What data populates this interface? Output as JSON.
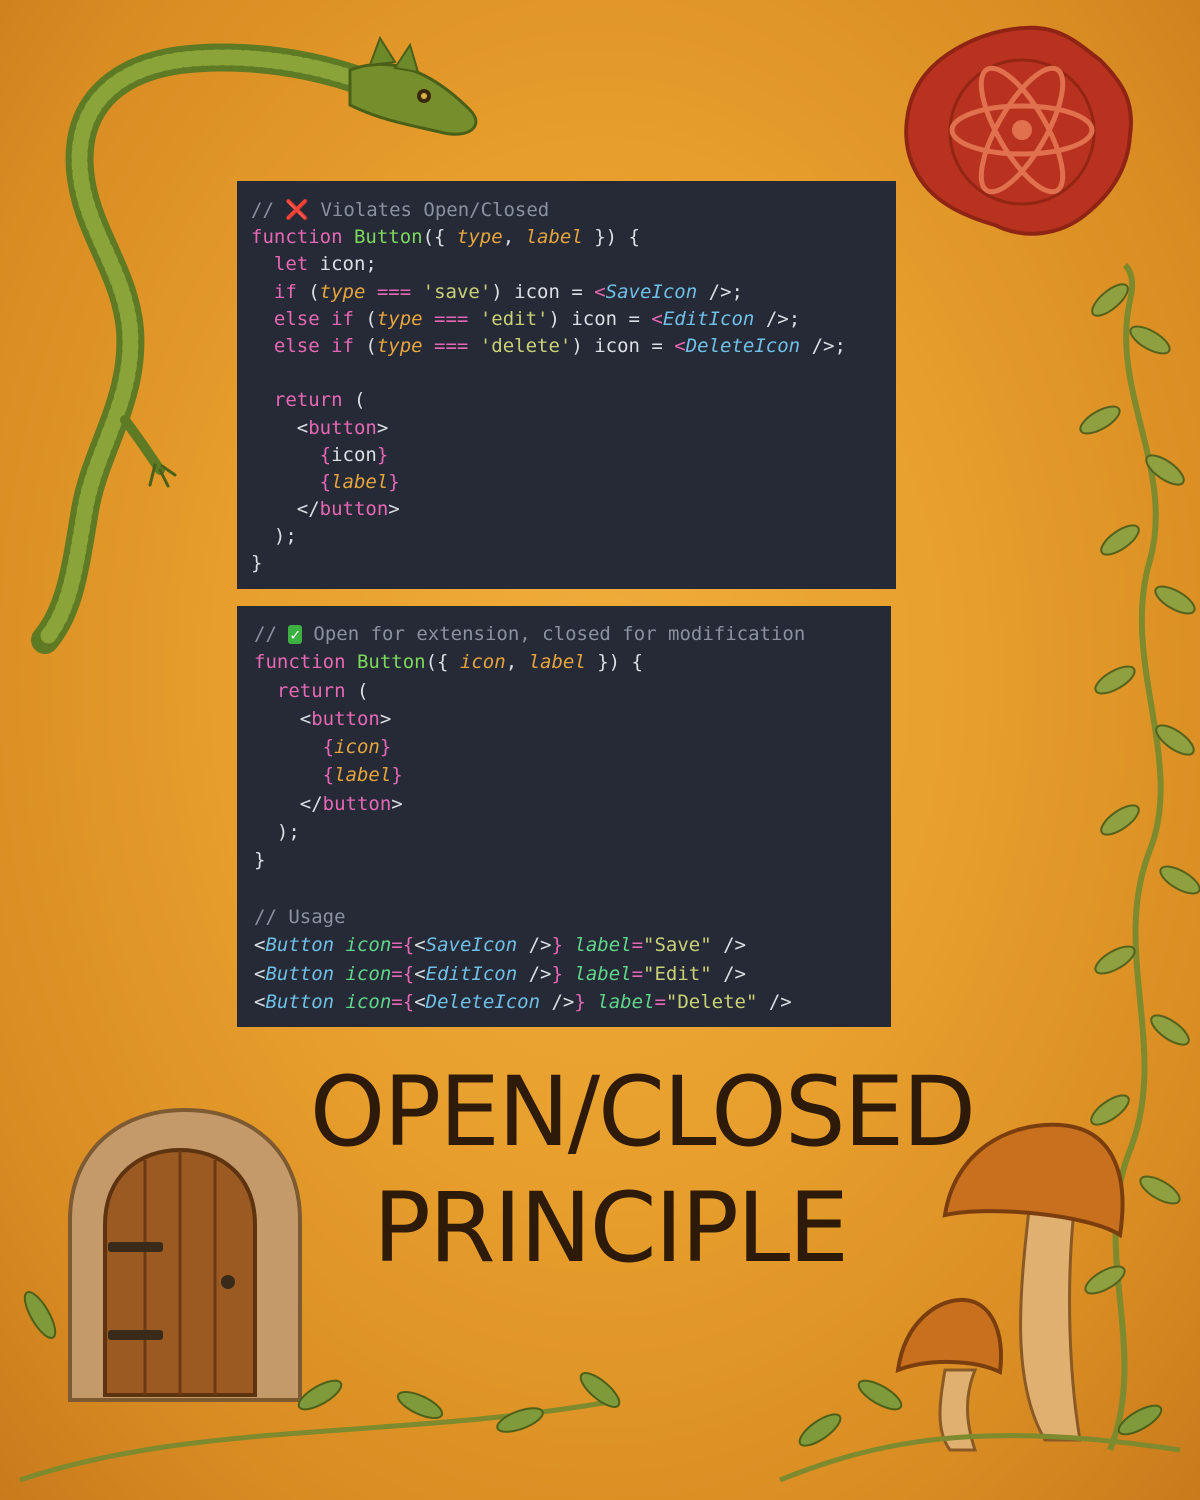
{
  "panel1": {
    "lines": [
      [
        {
          "t": "// ",
          "c": "com"
        },
        {
          "t": "❌",
          "c": "x"
        },
        {
          "t": " Violates Open/Closed",
          "c": "com"
        }
      ],
      [
        {
          "t": "function ",
          "c": "kw"
        },
        {
          "t": "Button",
          "c": "fn"
        },
        {
          "t": "({ ",
          "c": "pl"
        },
        {
          "t": "type",
          "c": "par"
        },
        {
          "t": ", ",
          "c": "pl"
        },
        {
          "t": "label",
          "c": "par"
        },
        {
          "t": " }) {",
          "c": "pl"
        }
      ],
      [
        {
          "t": "  let ",
          "c": "kw"
        },
        {
          "t": "icon;",
          "c": "pl"
        }
      ],
      [
        {
          "t": "  if ",
          "c": "kw"
        },
        {
          "t": "(",
          "c": "pl"
        },
        {
          "t": "type",
          "c": "par"
        },
        {
          "t": " === ",
          "c": "kw"
        },
        {
          "t": "'save'",
          "c": "str"
        },
        {
          "t": ") icon = ",
          "c": "pl"
        },
        {
          "t": "<",
          "c": "tag"
        },
        {
          "t": "SaveIcon",
          "c": "cmp"
        },
        {
          "t": " />;",
          "c": "pl"
        }
      ],
      [
        {
          "t": "  else if ",
          "c": "kw"
        },
        {
          "t": "(",
          "c": "pl"
        },
        {
          "t": "type",
          "c": "par"
        },
        {
          "t": " === ",
          "c": "kw"
        },
        {
          "t": "'edit'",
          "c": "str"
        },
        {
          "t": ") icon = ",
          "c": "pl"
        },
        {
          "t": "<",
          "c": "tag"
        },
        {
          "t": "EditIcon",
          "c": "cmp"
        },
        {
          "t": " />;",
          "c": "pl"
        }
      ],
      [
        {
          "t": "  else if ",
          "c": "kw"
        },
        {
          "t": "(",
          "c": "pl"
        },
        {
          "t": "type",
          "c": "par"
        },
        {
          "t": " === ",
          "c": "kw"
        },
        {
          "t": "'delete'",
          "c": "str"
        },
        {
          "t": ") icon = ",
          "c": "pl"
        },
        {
          "t": "<",
          "c": "tag"
        },
        {
          "t": "DeleteIcon",
          "c": "cmp"
        },
        {
          "t": " />;",
          "c": "pl"
        }
      ],
      [],
      [
        {
          "t": "  return ",
          "c": "kw"
        },
        {
          "t": "(",
          "c": "pl"
        }
      ],
      [
        {
          "t": "    <",
          "c": "pl"
        },
        {
          "t": "button",
          "c": "tag"
        },
        {
          "t": ">",
          "c": "pl"
        }
      ],
      [
        {
          "t": "      {",
          "c": "br"
        },
        {
          "t": "icon",
          "c": "pl"
        },
        {
          "t": "}",
          "c": "br"
        }
      ],
      [
        {
          "t": "      {",
          "c": "br"
        },
        {
          "t": "label",
          "c": "par"
        },
        {
          "t": "}",
          "c": "br"
        }
      ],
      [
        {
          "t": "    </",
          "c": "pl"
        },
        {
          "t": "button",
          "c": "tag"
        },
        {
          "t": ">",
          "c": "pl"
        }
      ],
      [
        {
          "t": "  );",
          "c": "pl"
        }
      ],
      [
        {
          "t": "}",
          "c": "pl"
        }
      ]
    ]
  },
  "panel2": {
    "lines": [
      [
        {
          "t": "// ",
          "c": "com"
        },
        {
          "t": "✓",
          "c": "ok"
        },
        {
          "t": " Open for extension, closed for modification",
          "c": "com"
        }
      ],
      [
        {
          "t": "function ",
          "c": "kw"
        },
        {
          "t": "Button",
          "c": "fn"
        },
        {
          "t": "({ ",
          "c": "pl"
        },
        {
          "t": "icon",
          "c": "par"
        },
        {
          "t": ", ",
          "c": "pl"
        },
        {
          "t": "label",
          "c": "par"
        },
        {
          "t": " }) {",
          "c": "pl"
        }
      ],
      [
        {
          "t": "  return ",
          "c": "kw"
        },
        {
          "t": "(",
          "c": "pl"
        }
      ],
      [
        {
          "t": "    <",
          "c": "pl"
        },
        {
          "t": "button",
          "c": "tag"
        },
        {
          "t": ">",
          "c": "pl"
        }
      ],
      [
        {
          "t": "      {",
          "c": "br"
        },
        {
          "t": "icon",
          "c": "par"
        },
        {
          "t": "}",
          "c": "br"
        }
      ],
      [
        {
          "t": "      {",
          "c": "br"
        },
        {
          "t": "label",
          "c": "par"
        },
        {
          "t": "}",
          "c": "br"
        }
      ],
      [
        {
          "t": "    </",
          "c": "pl"
        },
        {
          "t": "button",
          "c": "tag"
        },
        {
          "t": ">",
          "c": "pl"
        }
      ],
      [
        {
          "t": "  );",
          "c": "pl"
        }
      ],
      [
        {
          "t": "}",
          "c": "pl"
        }
      ],
      [],
      [
        {
          "t": "// Usage",
          "c": "com"
        }
      ],
      [
        {
          "t": "<",
          "c": "pl"
        },
        {
          "t": "Button",
          "c": "cmp"
        },
        {
          "t": " icon",
          "c": "attr"
        },
        {
          "t": "={",
          "c": "br"
        },
        {
          "t": "<",
          "c": "pl"
        },
        {
          "t": "SaveIcon",
          "c": "cmp"
        },
        {
          "t": " />",
          "c": "pl"
        },
        {
          "t": "}",
          "c": "br"
        },
        {
          "t": " label",
          "c": "attr"
        },
        {
          "t": "=",
          "c": "kw"
        },
        {
          "t": "\"Save\"",
          "c": "str"
        },
        {
          "t": " />",
          "c": "pl"
        }
      ],
      [
        {
          "t": "<",
          "c": "pl"
        },
        {
          "t": "Button",
          "c": "cmp"
        },
        {
          "t": " icon",
          "c": "attr"
        },
        {
          "t": "={",
          "c": "br"
        },
        {
          "t": "<",
          "c": "pl"
        },
        {
          "t": "EditIcon",
          "c": "cmp"
        },
        {
          "t": " />",
          "c": "pl"
        },
        {
          "t": "}",
          "c": "br"
        },
        {
          "t": " label",
          "c": "attr"
        },
        {
          "t": "=",
          "c": "kw"
        },
        {
          "t": "\"Edit\"",
          "c": "str"
        },
        {
          "t": " />",
          "c": "pl"
        }
      ],
      [
        {
          "t": "<",
          "c": "pl"
        },
        {
          "t": "Button",
          "c": "cmp"
        },
        {
          "t": " icon",
          "c": "attr"
        },
        {
          "t": "={",
          "c": "br"
        },
        {
          "t": "<",
          "c": "pl"
        },
        {
          "t": "DeleteIcon",
          "c": "cmp"
        },
        {
          "t": " />",
          "c": "pl"
        },
        {
          "t": "}",
          "c": "br"
        },
        {
          "t": " label",
          "c": "attr"
        },
        {
          "t": "=",
          "c": "kw"
        },
        {
          "t": "\"Delete\"",
          "c": "str"
        },
        {
          "t": " />",
          "c": "pl"
        }
      ]
    ]
  },
  "title": {
    "line1": "OPEN/CLOSED",
    "line2": "PRINCIPLE"
  },
  "decorations": [
    "dragon-illustration",
    "wax-seal-atom-icon",
    "climbing-vine",
    "arched-wooden-door",
    "mushrooms",
    "ground-vines"
  ]
}
